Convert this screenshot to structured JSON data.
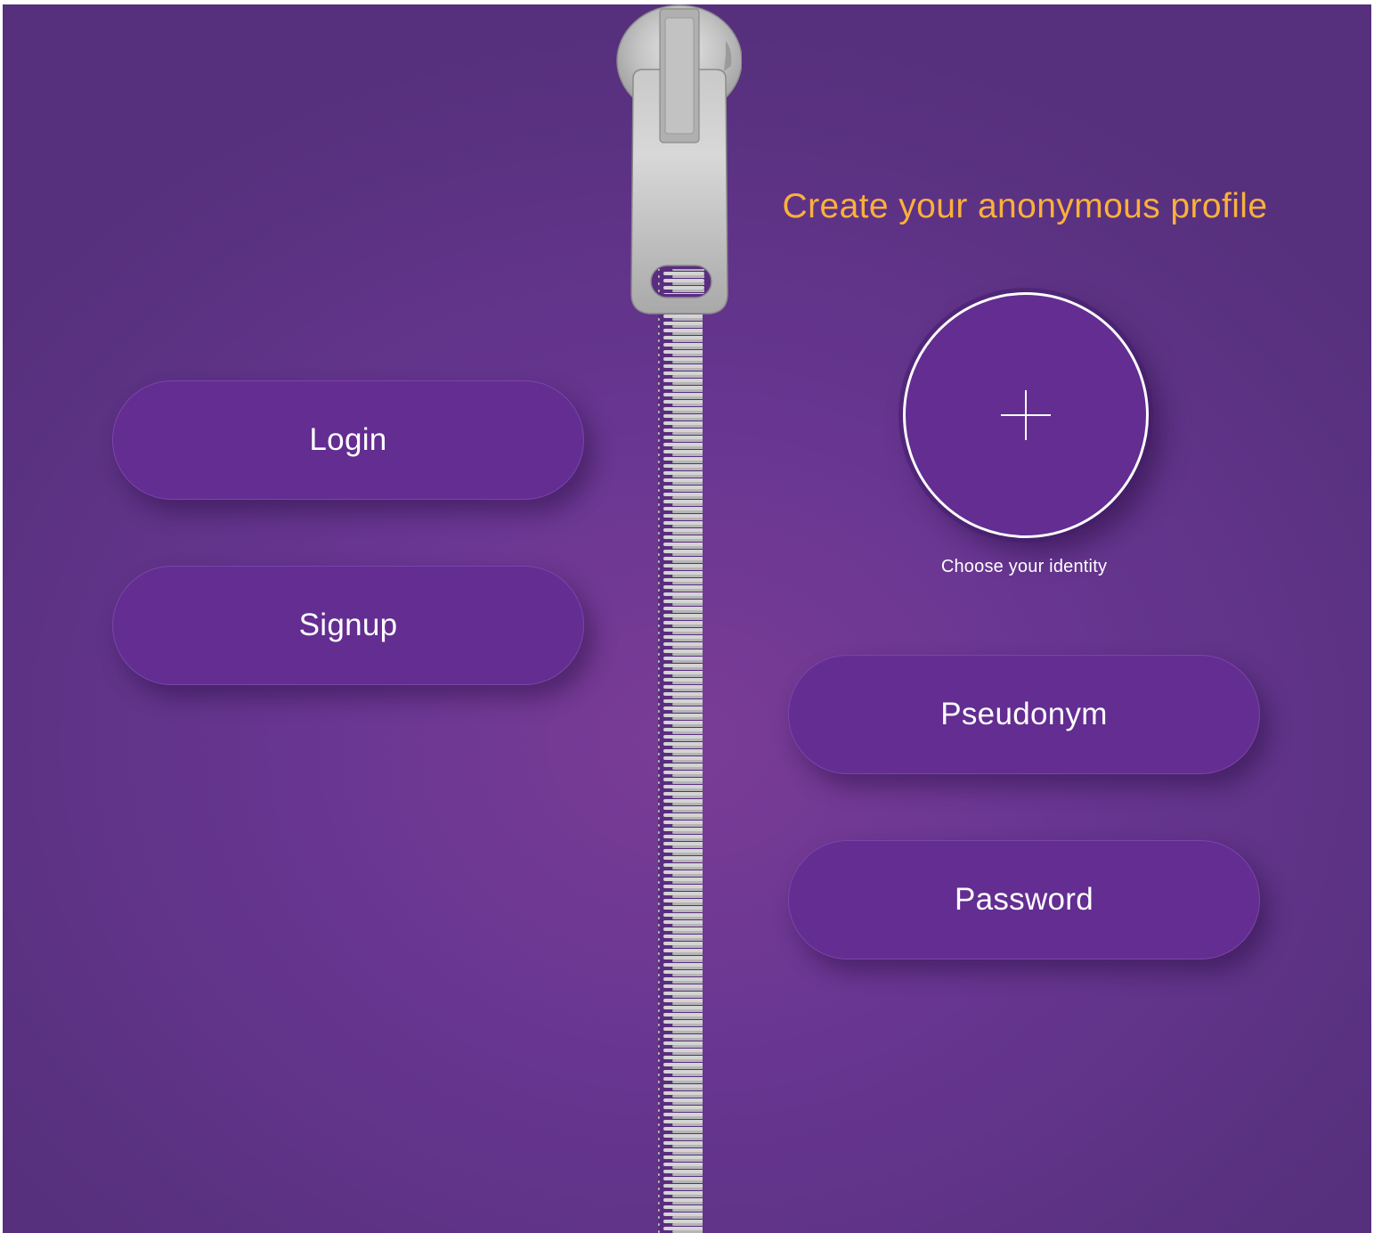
{
  "left_panel": {
    "login_label": "Login",
    "signup_label": "Signup"
  },
  "right_panel": {
    "title": "Create your anonymous profile",
    "avatar_icon": "plus-icon",
    "avatar_caption": "Choose your identity",
    "pseudonym_label": "Pseudonym",
    "password_label": "Password"
  },
  "colors": {
    "background": "#683691",
    "button": "#632d91",
    "title": "#fbb03b",
    "text": "#ffffff",
    "zipper": "#c4c4c4"
  }
}
